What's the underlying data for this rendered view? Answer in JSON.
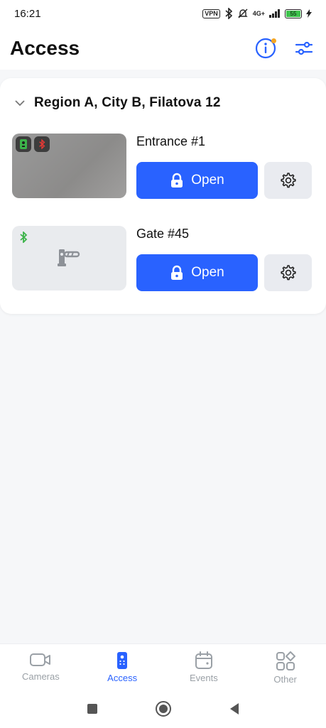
{
  "status_bar": {
    "time": "16:21",
    "vpn_label": "VPN",
    "network": "4G+",
    "battery": "55"
  },
  "header": {
    "title": "Access"
  },
  "region": {
    "label": "Region A, City B,  Filatova 12"
  },
  "devices": [
    {
      "name": "Entrance #1",
      "button_label": "Open",
      "thumbnail": "camera-photo",
      "badges": [
        "intercom-icon",
        "bluetooth-icon"
      ]
    },
    {
      "name": "Gate #45",
      "button_label": "Open",
      "thumbnail": "barrier-icon",
      "badges": [
        "bluetooth-icon"
      ]
    }
  ],
  "bottom_nav": [
    {
      "label": "Cameras",
      "icon": "camera-icon",
      "active": false
    },
    {
      "label": "Access",
      "icon": "remote-icon",
      "active": true
    },
    {
      "label": "Events",
      "icon": "calendar-icon",
      "active": false
    },
    {
      "label": "Other",
      "icon": "apps-icon",
      "active": false
    }
  ],
  "colors": {
    "accent": "#2962ff",
    "badge_dot": "#f5a623",
    "bluetooth_green": "#3cb34a",
    "bluetooth_red": "#e53935"
  }
}
